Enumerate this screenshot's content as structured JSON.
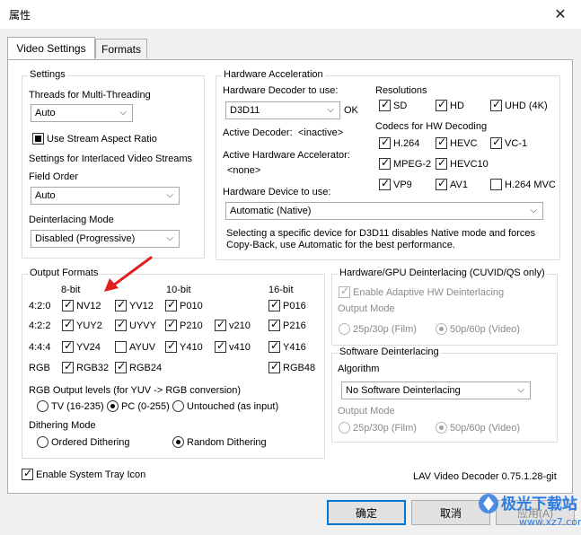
{
  "window": {
    "title": "属性",
    "close_glyph": "✕"
  },
  "tabs": [
    {
      "label": "Video Settings",
      "active": true
    },
    {
      "label": "Formats",
      "active": false
    }
  ],
  "settings": {
    "group_title": "Settings",
    "threads_label": "Threads for Multi-Threading",
    "threads_value": "Auto",
    "stream_aspect_label": "Use Stream Aspect Ratio",
    "interlaced_label": "Settings for Interlaced Video Streams",
    "field_order_label": "Field Order",
    "field_order_value": "Auto",
    "deinterlacing_mode_label": "Deinterlacing Mode",
    "deinterlacing_mode_value": "Disabled (Progressive)"
  },
  "hwaccel": {
    "group_title": "Hardware Acceleration",
    "decoder_label": "Hardware Decoder to use:",
    "decoder_value": "D3D11",
    "decoder_status": "OK",
    "active_decoder_label": "Active Decoder:",
    "active_decoder_value": "<inactive>",
    "active_accel_label": "Active Hardware Accelerator:",
    "active_accel_value": "<none>",
    "device_label": "Hardware Device to use:",
    "device_value": "Automatic (Native)",
    "note": "Selecting a specific device for D3D11 disables Native mode and forces Copy-Back, use Automatic for the best performance.",
    "resolutions_label": "Resolutions",
    "resolutions": [
      {
        "label": "SD",
        "checked": true
      },
      {
        "label": "HD",
        "checked": true
      },
      {
        "label": "UHD (4K)",
        "checked": true
      }
    ],
    "codecs_label": "Codecs for HW Decoding",
    "codecs": [
      {
        "label": "H.264",
        "checked": true
      },
      {
        "label": "HEVC",
        "checked": true
      },
      {
        "label": "VC-1",
        "checked": true
      },
      {
        "label": "MPEG-2",
        "checked": true
      },
      {
        "label": "HEVC10",
        "checked": true
      },
      {
        "label": "VP9",
        "checked": true
      },
      {
        "label": "AV1",
        "checked": true
      },
      {
        "label": "H.264 MVC",
        "checked": false
      }
    ]
  },
  "output_formats": {
    "group_title": "Output Formats",
    "headers": [
      "8-bit",
      "10-bit",
      "16-bit"
    ],
    "rows": [
      {
        "label": "4:2:0",
        "items": [
          {
            "label": "NV12",
            "checked": true
          },
          {
            "label": "YV12",
            "checked": true
          },
          {
            "label": "P010",
            "checked": true
          },
          {
            "label": "P016",
            "checked": true
          }
        ]
      },
      {
        "label": "4:2:2",
        "items": [
          {
            "label": "YUY2",
            "checked": true
          },
          {
            "label": "UYVY",
            "checked": true
          },
          {
            "label": "P210",
            "checked": true
          },
          {
            "label": "v210",
            "checked": true
          },
          {
            "label": "P216",
            "checked": true
          }
        ]
      },
      {
        "label": "4:4:4",
        "items": [
          {
            "label": "YV24",
            "checked": true
          },
          {
            "label": "AYUV",
            "checked": false
          },
          {
            "label": "Y410",
            "checked": true
          },
          {
            "label": "v410",
            "checked": true
          },
          {
            "label": "Y416",
            "checked": true
          }
        ]
      },
      {
        "label": "RGB",
        "items": [
          {
            "label": "RGB32",
            "checked": true
          },
          {
            "label": "RGB24",
            "checked": true
          },
          {
            "label": "RGB48",
            "checked": true
          }
        ]
      }
    ],
    "rgb_levels_label": "RGB Output levels (for YUV -> RGB conversion)",
    "rgb_levels": [
      {
        "label": "TV (16-235)",
        "selected": false
      },
      {
        "label": "PC (0-255)",
        "selected": true
      },
      {
        "label": "Untouched (as input)",
        "selected": false
      }
    ],
    "dithering_label": "Dithering Mode",
    "dithering": [
      {
        "label": "Ordered Dithering",
        "selected": false
      },
      {
        "label": "Random Dithering",
        "selected": true
      }
    ]
  },
  "hw_deint": {
    "group_title": "Hardware/GPU Deinterlacing (CUVID/QS only)",
    "adaptive_label": "Enable Adaptive HW Deinterlacing",
    "output_mode_label": "Output Mode",
    "modes": [
      {
        "label": "25p/30p (Film)",
        "selected": false
      },
      {
        "label": "50p/60p (Video)",
        "selected": true
      }
    ]
  },
  "sw_deint": {
    "group_title": "Software Deinterlacing",
    "algorithm_label": "Algorithm",
    "algorithm_value": "No Software Deinterlacing",
    "output_mode_label": "Output Mode",
    "modes": [
      {
        "label": "25p/30p (Film)",
        "selected": false
      },
      {
        "label": "50p/60p (Video)",
        "selected": true
      }
    ]
  },
  "footer": {
    "tray_label": "Enable System Tray Icon",
    "version": "LAV Video Decoder 0.75.1.28-git"
  },
  "buttons": {
    "ok": "确定",
    "cancel": "取消",
    "apply": "应用(A)"
  },
  "watermark": {
    "text": "极光下载站",
    "url": "www.xz7.com"
  },
  "colors": {
    "accent": "#0078d7",
    "arrow": "#e02020"
  }
}
